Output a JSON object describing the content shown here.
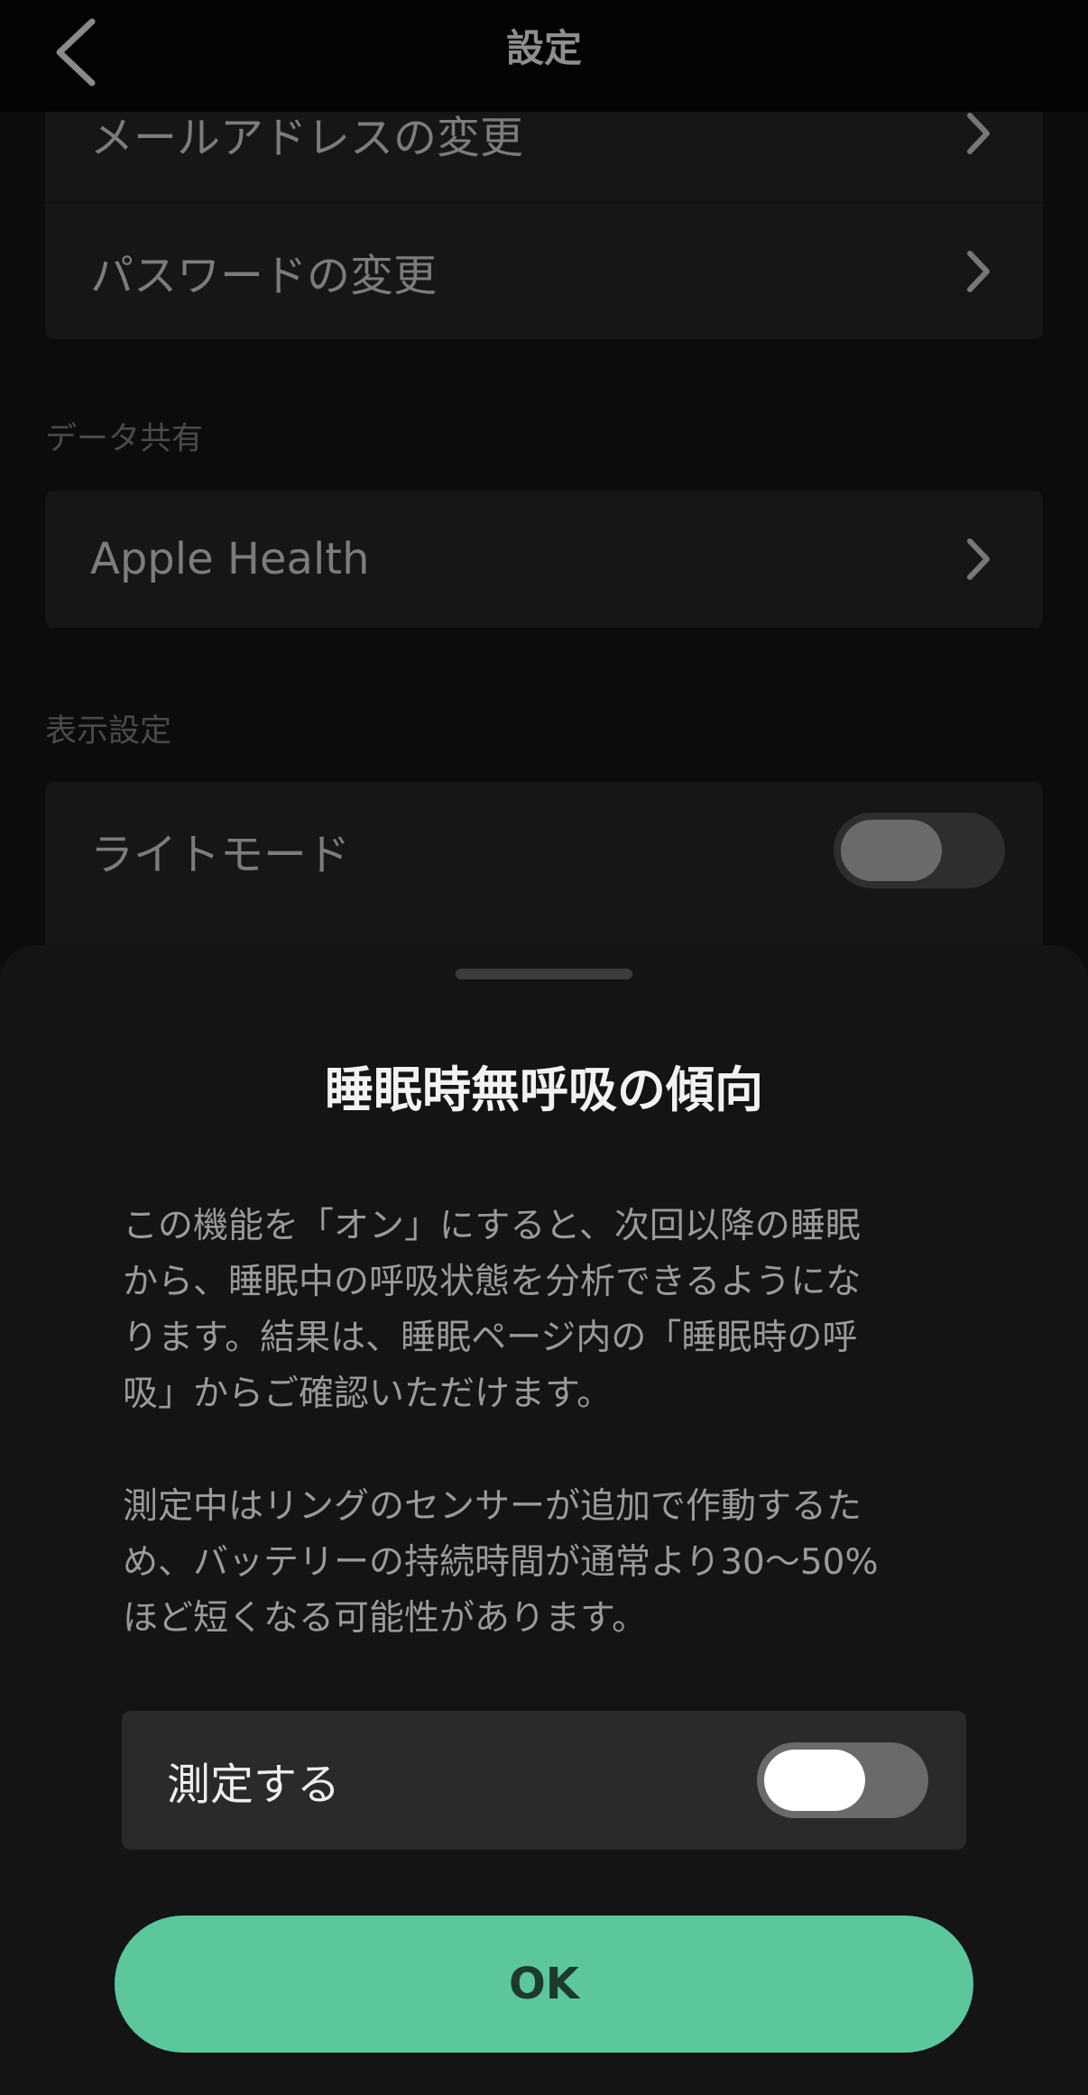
{
  "header": {
    "title": "設定",
    "back_icon": "chevron-left-icon"
  },
  "account": {
    "items": [
      {
        "label": "メールアドレスの変更",
        "icon": "chevron-right-icon"
      },
      {
        "label": "パスワードの変更",
        "icon": "chevron-right-icon"
      }
    ]
  },
  "data_sharing": {
    "section_label": "データ共有",
    "items": [
      {
        "label": "Apple Health",
        "icon": "chevron-right-icon"
      }
    ]
  },
  "display": {
    "section_label": "表示設定",
    "light_mode_label": "ライトモード",
    "light_mode_on": false
  },
  "sheet": {
    "title": "睡眠時無呼吸の傾向",
    "paragraph1": [
      "この機能を「オン」にすると、次回以降の睡眠",
      "から、睡眠中の呼吸状態を分析できるようにな",
      "ります。結果は、睡眠ページ内の「睡眠時の呼",
      "吸」からご確認いただけます。"
    ],
    "paragraph2": [
      "測定中はリングのセンサーが追加で作動するた",
      "め、バッテリーの持続時間が通常より30〜50%",
      "ほど短くなる可能性があります。"
    ],
    "measure_label": "測定する",
    "measure_on": false,
    "ok_label": "OK"
  },
  "colors": {
    "accent": "#5cc79b",
    "background": "#0c0c0c",
    "sheet_background": "#141414",
    "card_background": "#2a2a2a"
  }
}
